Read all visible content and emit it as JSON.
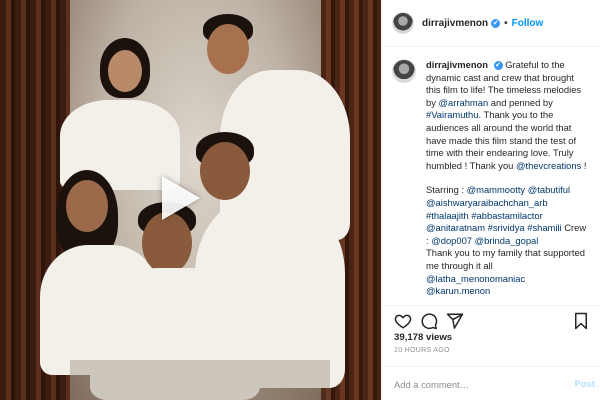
{
  "post": {
    "username": "dirrajivmenon",
    "follow_label": "Follow",
    "verified_mark": "✔",
    "separator": "•"
  },
  "caption": {
    "username": "dirrajivmenon",
    "line1_text": "Grateful to the dynamic cast and crew that brought this film to life! The timeless melodies by ",
    "mention_arrahman": "@arrahman",
    "line1_mid": " and penned by ",
    "tag_vairamuthu": "#Vairamuthu",
    "line1_end": ". Thank you to the audiences all around the world that have made this film stand the test of time with their endearing love. Truly humbled ! Thank you ",
    "mention_thevcreations": "@thevcreations",
    "line1_tail": " !",
    "starring_label": "Starring : ",
    "starring_mentions": "@mammootty @tabutiful @aishwaryaraibachchan_arb #thalaajith #abbastamilactor @anitaratnam #srividya #shamili",
    "crew_label": " Crew : ",
    "crew_mentions": "@dop007 @brinda_gopal",
    "family_text": "Thank you to my family that supported me through it all ",
    "family_mentions": "@latha_menonomaniac @karun.menon"
  },
  "icons": {
    "like": "heart-icon",
    "comment": "comment-icon",
    "share": "share-icon",
    "save": "bookmark-icon",
    "play": "play-icon"
  },
  "stats": {
    "likes": "39,178 views",
    "time": "10 HOURS AGO"
  },
  "comment_box": {
    "placeholder": "Add a comment…",
    "post_label": "Post"
  },
  "colors": {
    "link": "#00376b",
    "follow": "#0095f6",
    "verified": "#3897f0",
    "post_disabled": "#b2dffc"
  }
}
